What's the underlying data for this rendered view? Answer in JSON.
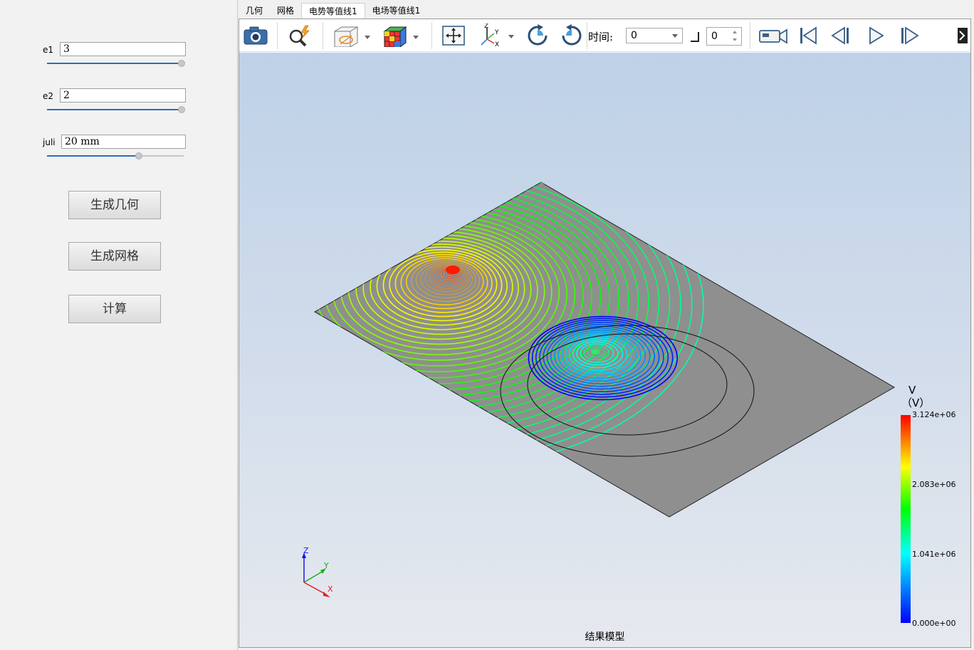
{
  "params": {
    "e1": {
      "label": "e1",
      "value": "3",
      "slider_fraction": 1.0
    },
    "e2": {
      "label": "e2",
      "value": "2",
      "slider_fraction": 1.0
    },
    "juli": {
      "label": "juli",
      "value": "20 mm",
      "slider_fraction": 0.67
    }
  },
  "buttons": {
    "generate_geometry": "生成几何",
    "generate_mesh": "生成网格",
    "compute": "计算"
  },
  "tabs": [
    {
      "label": "几何",
      "active": false
    },
    {
      "label": "网格",
      "active": false
    },
    {
      "label": "电势等值线1",
      "active": true
    },
    {
      "label": "电场等值线1",
      "active": false
    }
  ],
  "toolbar": {
    "time_label": "时间:",
    "time_value": "0",
    "frame_value": "0",
    "icons": [
      "camera-icon",
      "zoom-flash-icon",
      "clip-view-icon",
      "color-cube-icon",
      "fit-view-icon",
      "axes-orient-icon",
      "rotate-cw-icon",
      "rotate-ccw-icon",
      "record-video-icon",
      "first-frame-icon",
      "prev-frame-icon",
      "play-icon",
      "next-frame-icon",
      "expand-icon"
    ]
  },
  "viewport": {
    "title": "结果模型",
    "axes": {
      "x": "X",
      "y": "Y",
      "z": "Z"
    }
  },
  "colorbar": {
    "title": "V",
    "unit": "（V）",
    "ticks": [
      "3.124e+06",
      "2.083e+06",
      "1.041e+06",
      "0.000e+00"
    ],
    "colors": [
      "#0000ff",
      "#00ffff",
      "#00ff00",
      "#ffff00",
      "#ff0000"
    ]
  },
  "colors": {
    "plate": "#8f8f8f",
    "accent_blue": "#2a6fb6"
  }
}
